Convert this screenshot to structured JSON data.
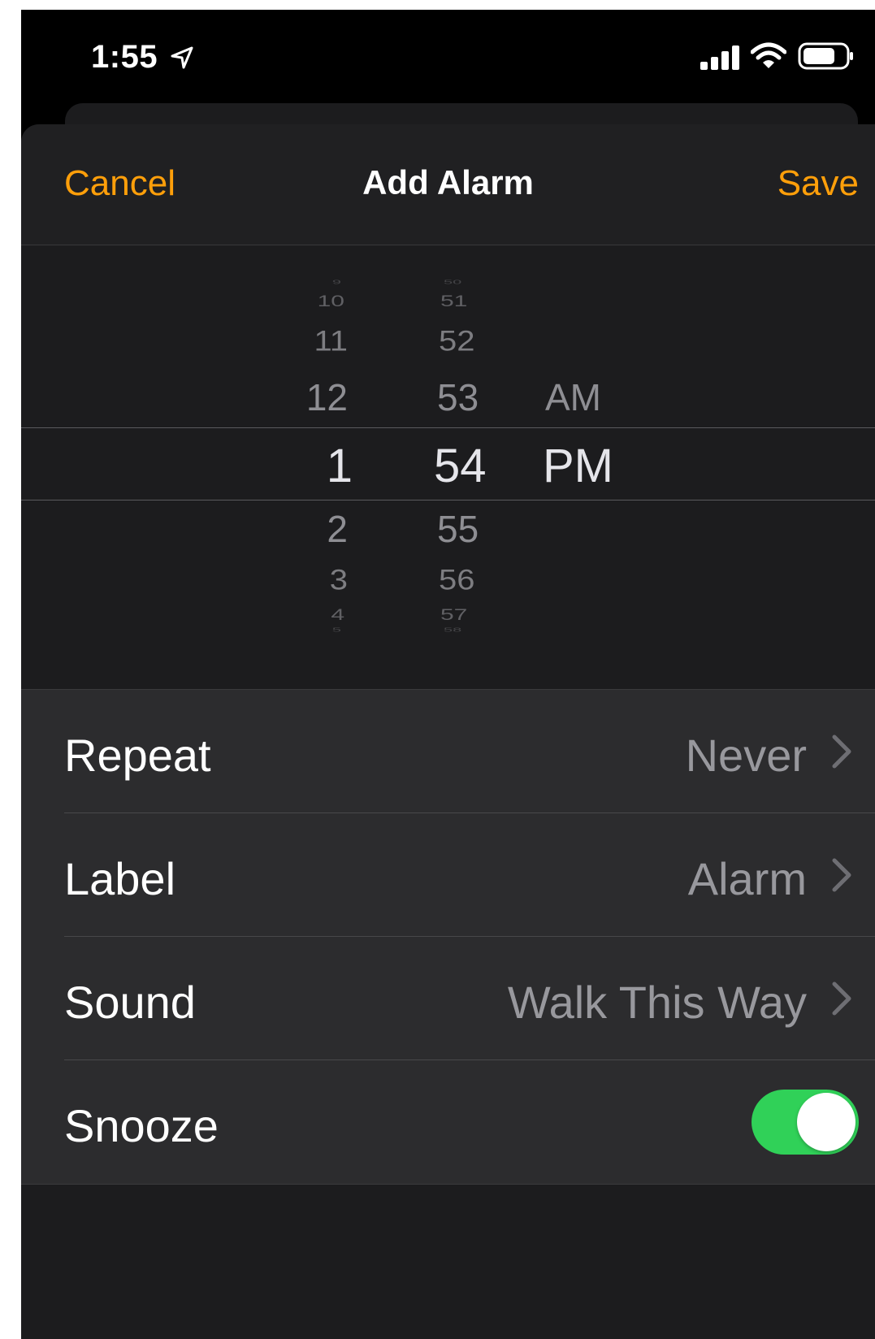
{
  "status_bar": {
    "time": "1:55"
  },
  "nav": {
    "cancel_label": "Cancel",
    "title": "Add Alarm",
    "save_label": "Save"
  },
  "picker": {
    "hours": [
      "9",
      "10",
      "11",
      "12",
      "1",
      "2",
      "3",
      "4",
      "5"
    ],
    "minutes": [
      "50",
      "51",
      "52",
      "53",
      "54",
      "55",
      "56",
      "57",
      "58"
    ],
    "periods": [
      "AM",
      "PM"
    ],
    "selected": {
      "hour": "1",
      "minute": "54",
      "period": "PM"
    }
  },
  "settings": {
    "repeat": {
      "label": "Repeat",
      "value": "Never"
    },
    "label": {
      "label": "Label",
      "value": "Alarm"
    },
    "sound": {
      "label": "Sound",
      "value": "Walk This Way"
    },
    "snooze": {
      "label": "Snooze",
      "enabled": true
    }
  },
  "colors": {
    "accent": "#ff9f0a",
    "toggle_on": "#30d158",
    "background": "#1c1c1e",
    "list_background": "#2c2c2e"
  }
}
